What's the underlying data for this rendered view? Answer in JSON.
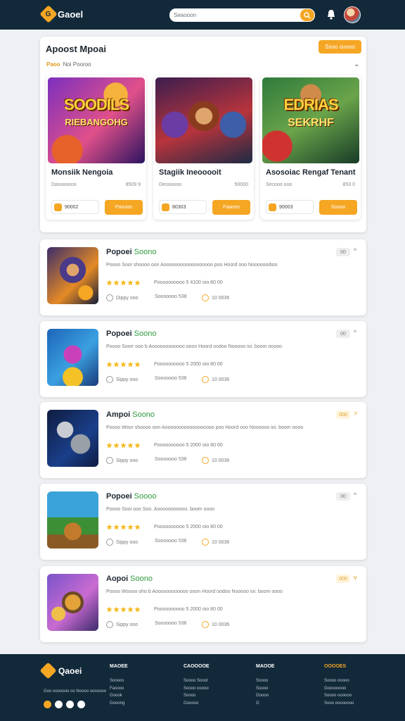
{
  "header": {
    "brand": "Gaoel",
    "search_placeholder": "Seaooon"
  },
  "featured": {
    "title": "Apoost Mpoai",
    "action_label": "Ssoo ouooo",
    "filter_key": "Paoo",
    "filter_value": "Noi Pooroo",
    "cards": [
      {
        "title": "Monsiik Nengoia",
        "meta_left": "Dasoooooo",
        "meta_right": "8509 9",
        "count": "90002",
        "button": "Paoooo",
        "art_line1": "SOODILS",
        "art_line2": "RIEBANGOHG",
        "art_colors": [
          "#7b2fbf",
          "#e0508a",
          "#2b1460"
        ]
      },
      {
        "title": "Stagiik Ineooooit",
        "meta_left": "Deoooooo",
        "meta_right": "50000",
        "count": "80303",
        "button": "Faaoeo",
        "art_line1": "",
        "art_line2": "",
        "art_colors": [
          "#3c1e4f",
          "#b8343c",
          "#1d2a45"
        ]
      },
      {
        "title": "Asosoiac Rengaf Tenant",
        "meta_left": "Secooo ooo",
        "meta_right": "853 0",
        "count": "90003",
        "button": "Soooo",
        "art_line1": "EDRIAS",
        "art_line2": "SEKRHF",
        "art_colors": [
          "#2f7a3c",
          "#b2322f",
          "#173b27"
        ]
      }
    ]
  },
  "list": [
    {
      "title": "Popoei",
      "tag": "Soono",
      "desc": "Poooo Soor shoooo oon Aoooooooooooooooooo poo Hoord ooo Noooooodioo",
      "rating_text": "Poooooooooo 5 4100 oio 80 00",
      "meta1": "Dippy ooo",
      "meta2": "Sooooooo 538",
      "meta3": "10 0036",
      "badge": "00",
      "badge_yellow": false,
      "chevron": "^",
      "thumb_colors": [
        "#3b2c6b",
        "#e58a25",
        "#141d3a"
      ]
    },
    {
      "title": "Popoei",
      "tag": "Soono",
      "desc": "Poooo Soorr ooo b Aoooooooooooo ooon Hoord oodoo Nooooo ioi. boom ooooo",
      "rating_text": "Poooooooooo 5 2000 oio 80 00",
      "meta1": "Sippy ooo",
      "meta2": "Sooooooo 536",
      "meta3": "10 0036",
      "badge": "00",
      "badge_yellow": false,
      "chevron": "^",
      "thumb_colors": [
        "#1e65b8",
        "#c941b8",
        "#f2c226"
      ]
    },
    {
      "title": "Ampoi",
      "tag": "Soono",
      "desc": "Poooo Woor shoooo oon Aoooooooooooooooooo poo Hoord ooo Noooooo ioi. boom oooo",
      "rating_text": "Poooooooooo 5 2000 oio 80 00",
      "meta1": "Sippy ooo",
      "meta2": "Sooooooo 536",
      "meta3": "10 0036",
      "badge": "000",
      "badge_yellow": true,
      "chevron": ">",
      "thumb_colors": [
        "#1a3f8a",
        "#9aa0a8",
        "#0f1c40"
      ]
    },
    {
      "title": "Popoei",
      "tag": "Soooo",
      "desc": "Poooo Sooi ooo Soo. Aooooooooooo. boom oooo",
      "rating_text": "Poooooooooo 5 2000 oio 80 00",
      "meta1": "Sippy ooo",
      "meta2": "Sooooooo 536",
      "meta3": "10 0036",
      "badge": "00",
      "badge_yellow": false,
      "chevron": "^",
      "thumb_colors": [
        "#3aa3d9",
        "#3d8f35",
        "#c27a2c"
      ]
    },
    {
      "title": "Aopoi",
      "tag": "Soono",
      "desc": "Poooo Woooo oho b Aoooooooooooo ooon Hoord oodoo Nooooo ioi. boom oooo",
      "rating_text": "Poooooooooo 5 2000 oio 80 00",
      "meta1": "Sippy ooo",
      "meta2": "Sooooooo 536",
      "meta3": "10 0036",
      "badge": "000",
      "badge_yellow": true,
      "chevron": "v",
      "thumb_colors": [
        "#7a53c9",
        "#e3a23a",
        "#3c2a6b"
      ]
    }
  ],
  "footer": {
    "brand": "Qaoei",
    "tagline": "Goo ooooooo oo Noooo ooooooo",
    "columns": [
      {
        "heading": "MAOEE",
        "links": [
          "Soooos",
          "Faoooo",
          "Goook",
          "Gooong"
        ],
        "highlight": false
      },
      {
        "heading": "CAOOOOE",
        "links": [
          "Soooo Soool",
          "Soooo ooooo",
          "Soooo",
          "Gooooo"
        ],
        "highlight": false
      },
      {
        "heading": "MAOOE",
        "links": [
          "Soooo",
          "Soooo",
          "Goooo",
          "G"
        ],
        "highlight": false
      },
      {
        "heading": "OOOOES",
        "links": [
          "Soooo ooooo",
          "Goooooooo",
          "Soooo oooooo",
          "Sooo oooooooo"
        ],
        "highlight": true
      }
    ]
  },
  "colors": {
    "accent": "#f5a623",
    "header_bg": "#12293a",
    "tag_green": "#2e9a3c"
  },
  "icons": [
    "logo-icon",
    "search-icon",
    "bell-icon",
    "avatar",
    "chevron-down-icon",
    "star-icon",
    "clock-icon",
    "coin-icon"
  ]
}
